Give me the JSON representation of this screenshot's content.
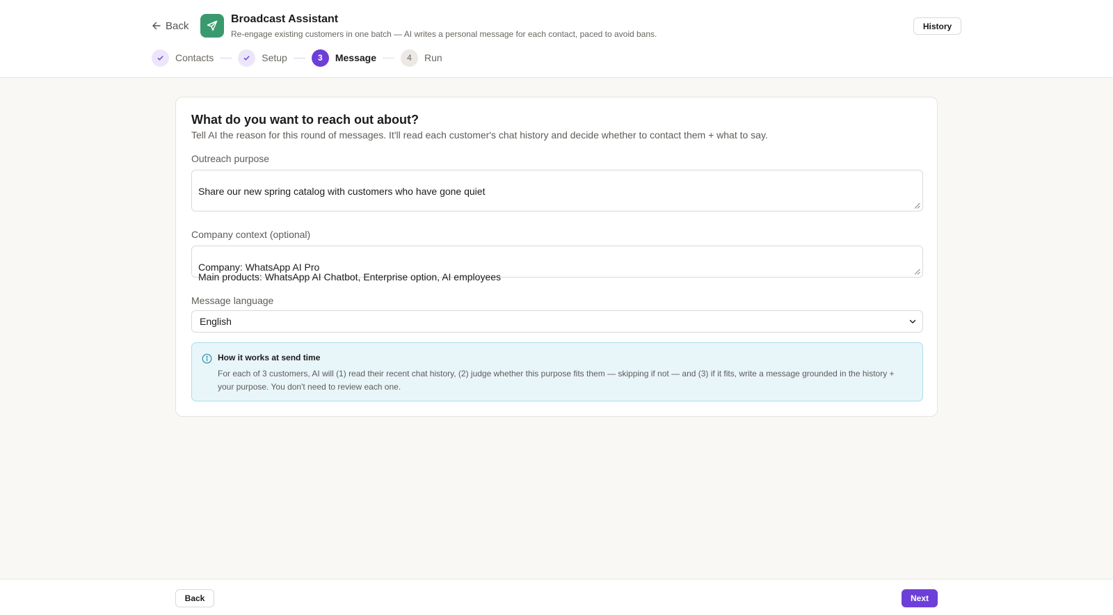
{
  "header": {
    "back_label": "Back",
    "app_icon": "send-icon",
    "title": "Broadcast Assistant",
    "subtitle": "Re-engage existing customers in one batch — AI writes a personal message for each contact, paced to avoid bans.",
    "history_label": "History"
  },
  "stepper": {
    "steps": [
      {
        "marker": "check-icon",
        "label": "Contacts",
        "state": "done"
      },
      {
        "marker": "check-icon",
        "label": "Setup",
        "state": "done"
      },
      {
        "marker": "3",
        "label": "Message",
        "state": "active"
      },
      {
        "marker": "4",
        "label": "Run",
        "state": "pending"
      }
    ]
  },
  "card": {
    "heading": "What do you want to reach out about?",
    "description": "Tell AI the reason for this round of messages. It'll read each customer's chat history and decide whether to contact them + what to say.",
    "purpose": {
      "label": "Outreach purpose",
      "value": "Share our new spring catalog with customers who have gone quiet"
    },
    "context": {
      "label": "Company context (optional)",
      "value": "Company: WhatsApp AI Pro\nMain products: WhatsApp AI Chatbot, Enterprise option, AI employees"
    },
    "language": {
      "label": "Message language",
      "selected": "English"
    },
    "info": {
      "icon": "info-icon",
      "title": "How it works at send time",
      "text": "For each of 3 customers, AI will (1) read their recent chat history, (2) judge whether this purpose fits them — skipping if not — and (3) if it fits, write a message grounded in the history + your purpose. You don't need to review each one."
    }
  },
  "footer": {
    "back_label": "Back",
    "next_label": "Next"
  },
  "colors": {
    "accent": "#6d3fd8",
    "brand_icon_bg": "#3a9a6e",
    "info_bg": "#e8f6fa",
    "page_bg": "#faf8f5"
  }
}
